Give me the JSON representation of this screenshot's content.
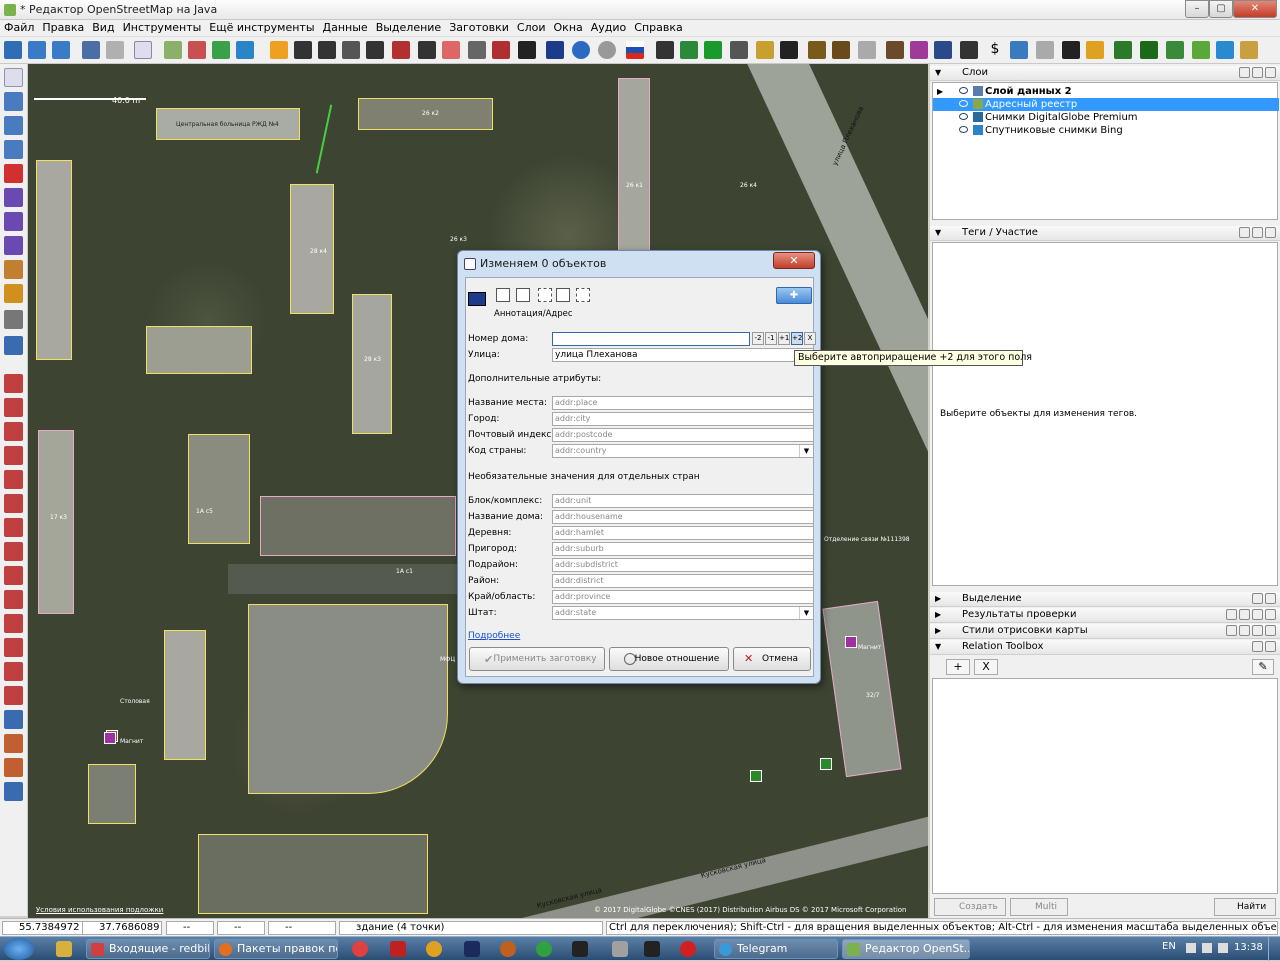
{
  "window": {
    "title": "* Редактор OpenStreetMap на Java",
    "controls": [
      "–",
      "▢",
      "✕"
    ]
  },
  "menu": [
    "Файл",
    "Правка",
    "Вид",
    "Инструменты",
    "Ещё инструменты",
    "Данные",
    "Выделение",
    "Заготовки",
    "Слои",
    "Окна",
    "Аудио",
    "Справка"
  ],
  "map": {
    "scale_label": "40.0 m",
    "labels": {
      "hospital": "Центральная больница РЖД №4",
      "b26k2": "26 к2",
      "b26k1": "26 к1",
      "b26k4": "26 к4",
      "b26k3": "26 к3",
      "b28k4": "28 к4",
      "b28k3": "28 к3",
      "b17k3": "17 к3",
      "b1ac5": "1А с5",
      "b1ac1": "1А с1",
      "post": "Отделение связи №111398",
      "magnit1": "Магнит",
      "magnit2": "Магнит",
      "stolovaya": "Столовая",
      "b32_7": "32/7",
      "mfc": "МФЦ",
      "street1": "улица Плеханова",
      "street2": "Кусковская улица",
      "street3": "Кусковская улица",
      "attribution": "© 2017 DigitalGlobe ©CNES (2017) Distribution Airbus DS © 2017 Microsoft Corporation",
      "usage_link": "Условия использования подложки"
    }
  },
  "layers_panel": {
    "title": "Слои",
    "layers": [
      {
        "name": "Слой данных 2",
        "bold": true
      },
      {
        "name": "Адресный реестр",
        "selected": true
      },
      {
        "name": "Снимки DigitalGlobe Premium"
      },
      {
        "name": "Спутниковые снимки Bing"
      }
    ]
  },
  "tags_panel": {
    "title": "Теги / Участие",
    "empty_text": "Выберите объекты для изменения тегов."
  },
  "collapsed_panels": [
    "Выделение",
    "Результаты проверки",
    "Стили отрисовки карты",
    "Relation Toolbox"
  ],
  "relation_toolbox": {
    "add": "+",
    "remove": "X"
  },
  "bottom_buttons": {
    "create": "Создать",
    "multi": "Multi",
    "find": "Найти"
  },
  "dialog": {
    "title": "Изменяем 0 объектов",
    "close": "✕",
    "preset_name": "Аннотация/Адрес",
    "house_number_label": "Номер дома:",
    "house_number_value": "",
    "spin_buttons": [
      "-2",
      "-1",
      "+1",
      "+2",
      "X"
    ],
    "street_label": "Улица:",
    "street_value": "улица Плеханова",
    "additional_header": "Дополнительные атрибуты:",
    "fields": [
      {
        "label": "Название места:",
        "placeholder": "addr:place"
      },
      {
        "label": "Город:",
        "placeholder": "addr:city"
      },
      {
        "label": "Почтовый индекс:",
        "placeholder": "addr:postcode"
      },
      {
        "label": "Код страны:",
        "placeholder": "addr:country"
      }
    ],
    "optional_header": "Необязательные значения для отдельных стран",
    "optional_fields": [
      {
        "label": "Блок/комплекс:",
        "placeholder": "addr:unit"
      },
      {
        "label": "Название дома:",
        "placeholder": "addr:housename"
      },
      {
        "label": "Деревня:",
        "placeholder": "addr:hamlet"
      },
      {
        "label": "Пригород:",
        "placeholder": "addr:suburb"
      },
      {
        "label": "Подрайон:",
        "placeholder": "addr:subdistrict"
      },
      {
        "label": "Район:",
        "placeholder": "addr:district"
      },
      {
        "label": "Край/область:",
        "placeholder": "addr:province"
      },
      {
        "label": "Штат:",
        "placeholder": "addr:state"
      }
    ],
    "more_link": "Подробнее",
    "apply_button": "Применить заготовку",
    "new_relation_button": "Новое отношение",
    "cancel_button": "Отмена"
  },
  "tooltip": "Выберите автоприращение +2 для этого поля",
  "status": {
    "lat": "55.7384972",
    "lon": "37.7686089",
    "heading": "--",
    "angle": "--",
    "length": "--",
    "selection": "здание (4 точки)",
    "hint": "Ctrl для переключения); Shift-Ctrl - для вращения выделенных объектов; Alt-Ctrl - для изменения масштаба выделенных объектов; или для изменения выделения"
  },
  "taskbar": {
    "tasks": [
      "Входящие - redbik...",
      "Пакеты правок по...",
      "Telegram",
      "Редактор OpenSt..."
    ],
    "lang": "EN",
    "time": "13:38"
  },
  "colors": {
    "accent_selection": "#3399ff",
    "building_outline": "#f0e060",
    "tag_outline": "#e8a8c8",
    "taskbar": "#2b4d74"
  }
}
